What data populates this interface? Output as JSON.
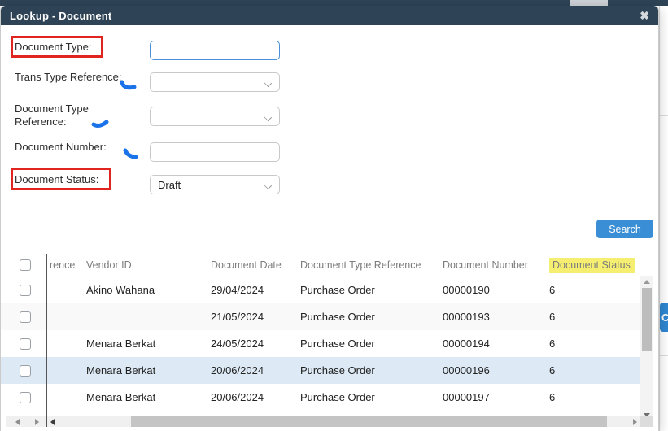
{
  "modal": {
    "title": "Lookup - Document",
    "close_icon": "✖"
  },
  "form": {
    "fields": [
      {
        "label": "Document Type:",
        "type": "text-input",
        "value": "",
        "annotation": "red-box",
        "focused": true
      },
      {
        "label": "Trans Type Reference:",
        "type": "select",
        "value": "",
        "annotation": "blue-pen-mark"
      },
      {
        "label": "Document Type Reference:",
        "type": "select",
        "value": "",
        "annotation": "blue-pen-mark"
      },
      {
        "label": "Document Number:",
        "type": "text-input",
        "value": "",
        "annotation": "blue-pen-mark"
      },
      {
        "label": "Document Status:",
        "type": "select",
        "value": "Draft",
        "annotation": "red-box"
      }
    ],
    "search_label": "Search"
  },
  "table": {
    "columns": [
      "rence",
      "Vendor ID",
      "Document Date",
      "Document Type Reference",
      "Document Number",
      "Document Status"
    ],
    "highlighted_column": "Document Status",
    "rows": [
      {
        "reference": "",
        "vendor_id": "Akino Wahana",
        "document_date": "29/04/2024",
        "document_type_reference": "Purchase Order",
        "document_number": "00000190",
        "document_status": "6",
        "selected": false
      },
      {
        "reference": "",
        "vendor_id": "",
        "document_date": "21/05/2024",
        "document_type_reference": "Purchase Order",
        "document_number": "00000193",
        "document_status": "6",
        "selected": false
      },
      {
        "reference": "",
        "vendor_id": "Menara Berkat",
        "document_date": "24/05/2024",
        "document_type_reference": "Purchase Order",
        "document_number": "00000194",
        "document_status": "6",
        "selected": false
      },
      {
        "reference": "",
        "vendor_id": "Menara Berkat",
        "document_date": "20/06/2024",
        "document_type_reference": "Purchase Order",
        "document_number": "00000196",
        "document_status": "6",
        "selected": true
      },
      {
        "reference": "",
        "vendor_id": "Menara Berkat",
        "document_date": "20/06/2024",
        "document_type_reference": "Purchase Order",
        "document_number": "00000197",
        "document_status": "6",
        "selected": false
      }
    ]
  },
  "background": {
    "partial_button_label": "C"
  },
  "colors": {
    "header_bg": "#2e4456",
    "accent_blue": "#3a8ed5",
    "focus_border": "#4a90d9",
    "annotation_red": "#e02420",
    "annotation_yellow": "#f5ee71",
    "annotation_blue": "#1a73e8",
    "selected_row": "#ddeaf6"
  }
}
